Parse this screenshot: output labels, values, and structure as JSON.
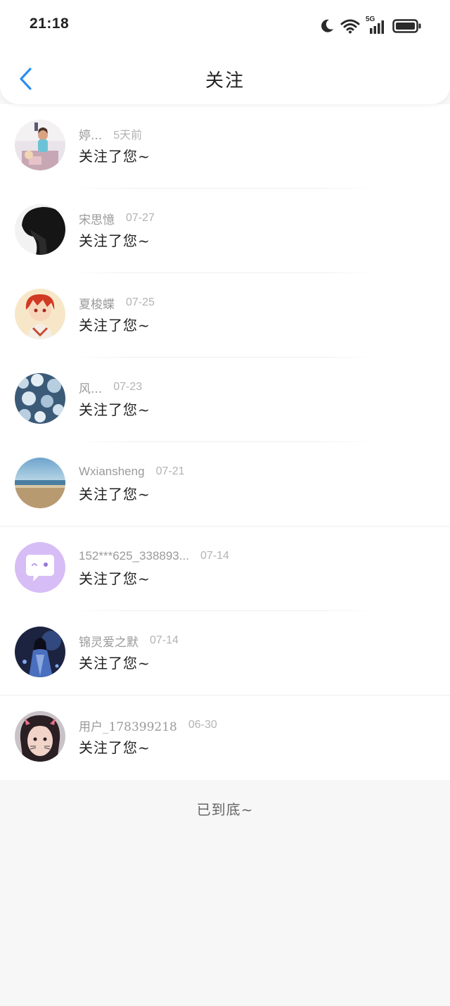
{
  "status_bar": {
    "time": "21:18",
    "network": "5G"
  },
  "header": {
    "title": "关注"
  },
  "notifications": [
    {
      "name": "婷...",
      "time": "5天前",
      "action": "关注了您~",
      "avatar": "girl-photo-avatar"
    },
    {
      "name": "宋思憶",
      "time": "07-27",
      "action": "关注了您~",
      "avatar": "silhouette-avatar"
    },
    {
      "name": "夏梭蝶",
      "time": "07-25",
      "action": "关注了您~",
      "avatar": "anime-boy-avatar"
    },
    {
      "name": "风...",
      "time": "07-23",
      "action": "关注了您~",
      "avatar": "snow-pattern-avatar"
    },
    {
      "name": "Wxiansheng",
      "time": "07-21",
      "action": "关注了您~",
      "avatar": "beach-avatar"
    },
    {
      "name": "152***625_338893...",
      "time": "07-14",
      "action": "关注了您~",
      "avatar": "chat-bubble-avatar"
    },
    {
      "name": "锦灵爱之默",
      "time": "07-14",
      "action": "关注了您~",
      "avatar": "fantasy-avatar"
    },
    {
      "name": "用户_178399218",
      "time": "06-30",
      "action": "关注了您~",
      "avatar": "cat-filter-avatar"
    }
  ],
  "footer": {
    "end_text": "已到底~"
  },
  "colors": {
    "accent": "#2c8ff0",
    "avatar_purple": "#d7bdf6",
    "page_bg": "#f8f7f8"
  }
}
